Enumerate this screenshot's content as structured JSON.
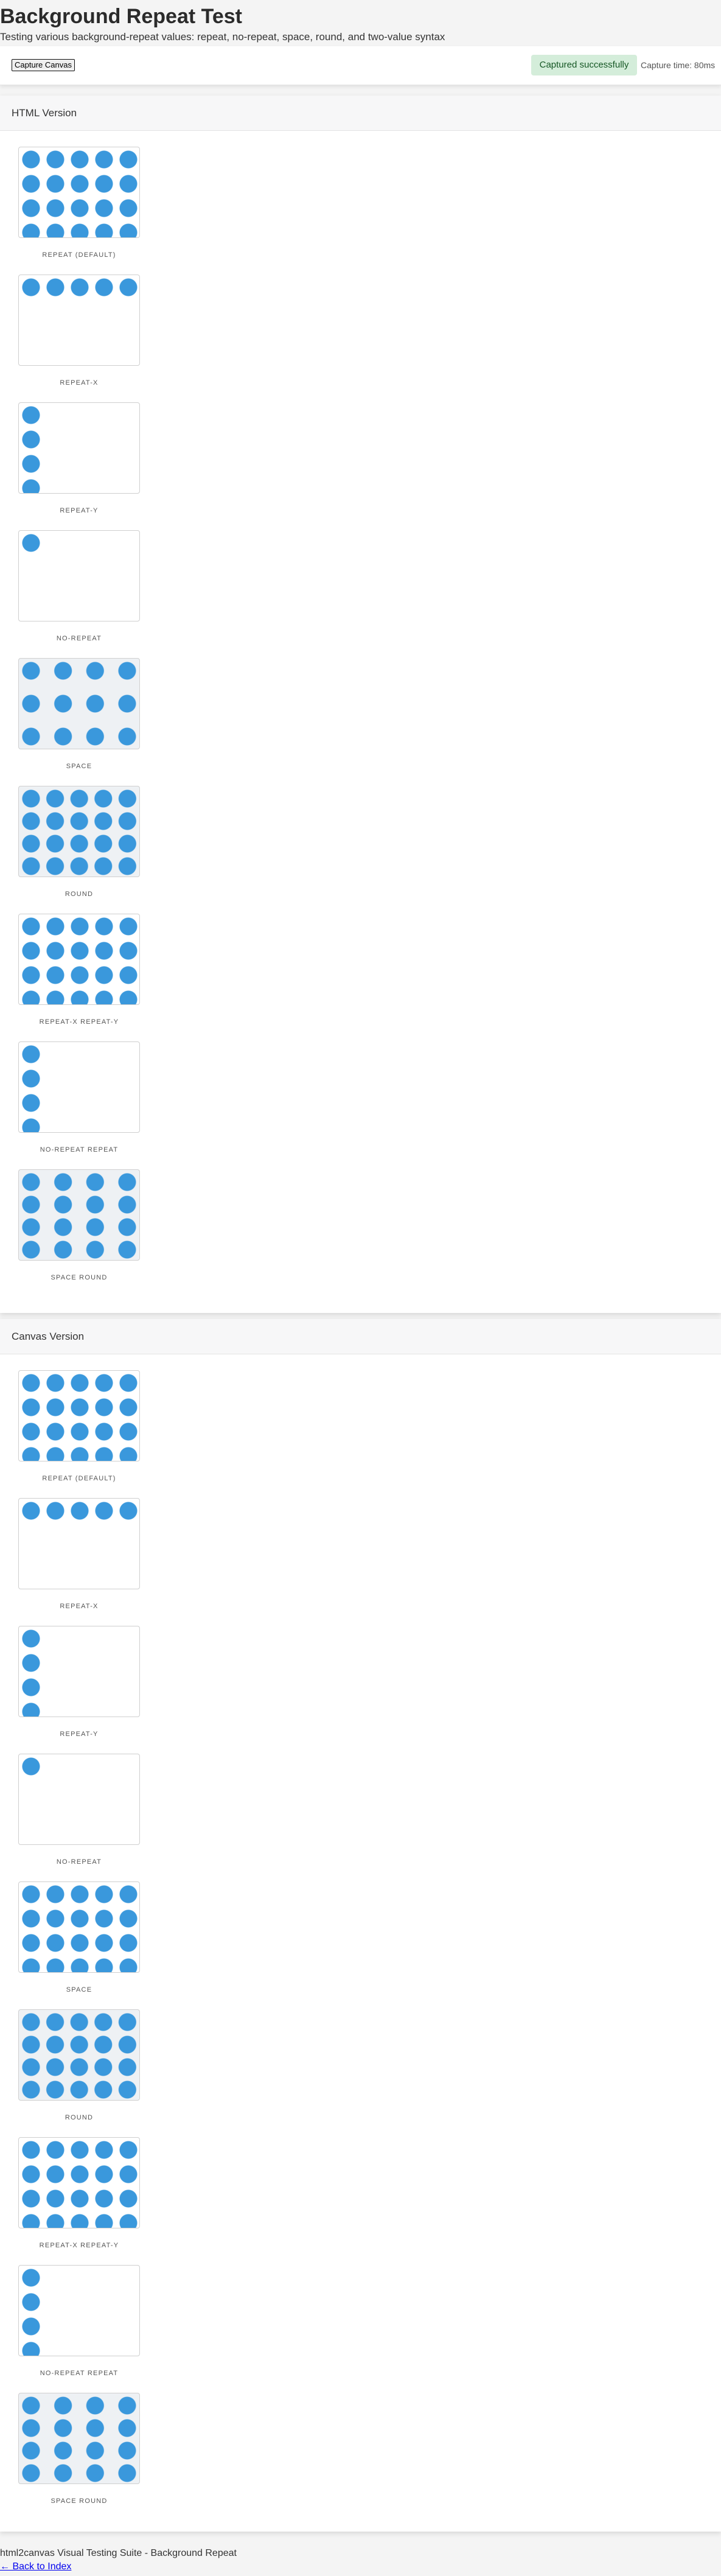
{
  "page": {
    "title": "Background Repeat Test",
    "subtitle": "Testing various background-repeat values: repeat, no-repeat, space, round, and two-value syntax"
  },
  "toolbar": {
    "capture_label": "Capture Canvas",
    "status": "Captured successfully",
    "capture_time": "Capture time: 80ms",
    "colors": {
      "status_bg": "#d4edda",
      "status_text": "#155724"
    }
  },
  "sections": {
    "html": {
      "title": "HTML Version",
      "tests": [
        {
          "label": "REPEAT (DEFAULT)"
        },
        {
          "label": "REPEAT-X"
        },
        {
          "label": "REPEAT-Y"
        },
        {
          "label": "NO-REPEAT"
        },
        {
          "label": "SPACE"
        },
        {
          "label": "ROUND"
        },
        {
          "label": "REPEAT-X REPEAT-Y"
        },
        {
          "label": "NO-REPEAT REPEAT"
        },
        {
          "label": "SPACE ROUND"
        }
      ]
    },
    "canvas": {
      "title": "Canvas Version",
      "tests": [
        {
          "label": "REPEAT (DEFAULT)"
        },
        {
          "label": "REPEAT-X"
        },
        {
          "label": "REPEAT-Y"
        },
        {
          "label": "NO-REPEAT"
        },
        {
          "label": "SPACE"
        },
        {
          "label": "ROUND"
        },
        {
          "label": "REPEAT-X REPEAT-Y"
        },
        {
          "label": "NO-REPEAT REPEAT"
        },
        {
          "label": "SPACE ROUND"
        }
      ]
    }
  },
  "pattern": {
    "dot_color": "#3a98dc",
    "icon": "circle-dot-pattern"
  },
  "footer": {
    "text": "html2canvas Visual Testing Suite - Background Repeat",
    "back_link": "← Back to Index"
  }
}
